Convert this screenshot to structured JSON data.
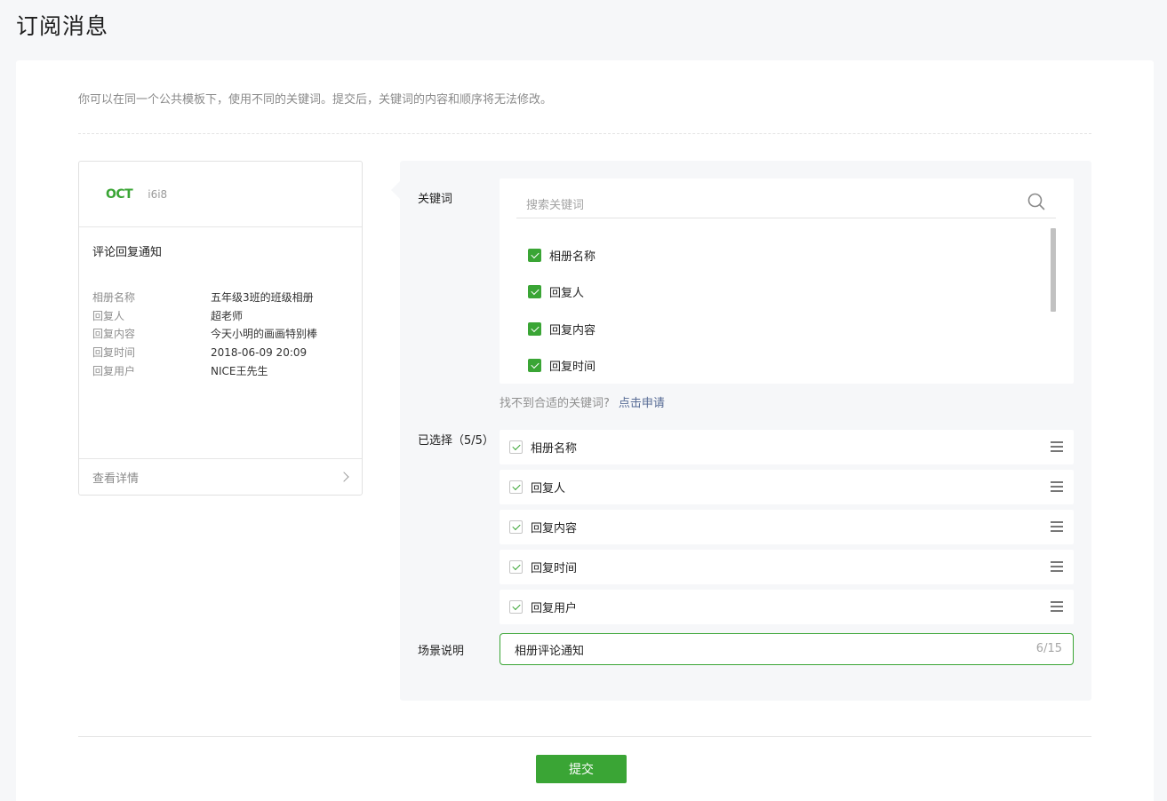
{
  "page": {
    "title": "订阅消息"
  },
  "main": {
    "tip": "你可以在同一个公共模板下，使用不同的关键词。提交后，关键词的内容和顺序将无法修改。"
  },
  "preview": {
    "logo_text": "OCT",
    "account_name": "i6i8",
    "title": "评论回复通知",
    "rows": [
      {
        "key": "相册名称",
        "value": "五年级3班的班级相册"
      },
      {
        "key": "回复人",
        "value": "超老师"
      },
      {
        "key": "回复内容",
        "value": "今天小明的画画特别棒"
      },
      {
        "key": "回复时间",
        "value": "2018-06-09 20:09"
      },
      {
        "key": "回复用户",
        "value": "NICE王先生"
      }
    ],
    "footer_label": "查看详情"
  },
  "keywords": {
    "label": "关键词",
    "search_placeholder": "搜索关键词",
    "items": [
      {
        "label": "相册名称",
        "checked": true
      },
      {
        "label": "回复人",
        "checked": true
      },
      {
        "label": "回复内容",
        "checked": true
      },
      {
        "label": "回复时间",
        "checked": true
      }
    ],
    "not_found_text": "找不到合适的关键词?",
    "apply_link": "点击申请"
  },
  "selected": {
    "label": "已选择（5/5）",
    "items": [
      {
        "label": "相册名称"
      },
      {
        "label": "回复人"
      },
      {
        "label": "回复内容"
      },
      {
        "label": "回复时间"
      },
      {
        "label": "回复用户"
      }
    ]
  },
  "scene": {
    "label": "场景说明",
    "value": "相册评论通知",
    "count": "6/15"
  },
  "submit_label": "提交",
  "colors": {
    "accent": "#3aa535",
    "link": "#576b95"
  },
  "icons": {
    "search": "search-icon",
    "drag": "drag-handle-icon",
    "chevron": "chevron-right-icon"
  }
}
